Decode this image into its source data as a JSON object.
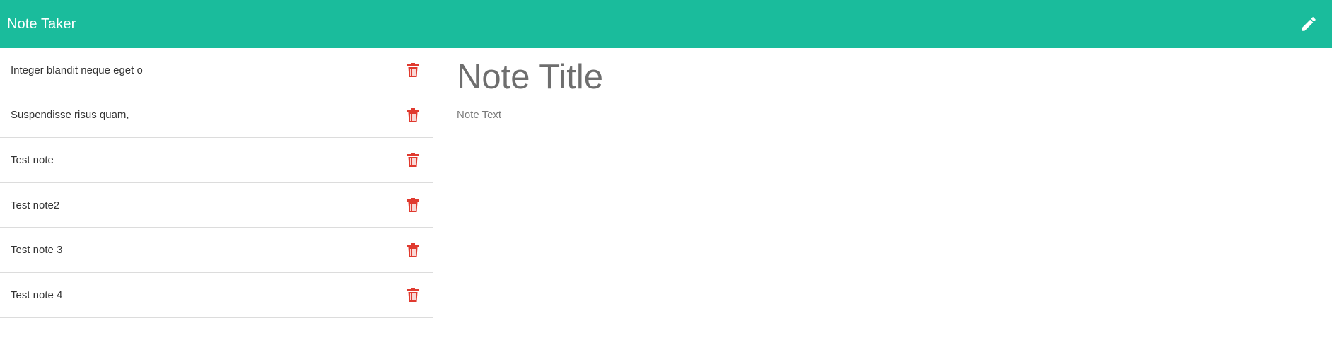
{
  "colors": {
    "navbar_bg": "#1abc9c",
    "delete_icon": "#e03a2f",
    "nav_text": "#ffffff"
  },
  "navbar": {
    "brand": "Note Taker",
    "new_note_icon": "pencil-icon"
  },
  "sidebar": {
    "notes": [
      {
        "title": "Integer blandit neque eget o",
        "delete_icon": "trash-icon"
      },
      {
        "title": "Suspendisse risus quam,",
        "delete_icon": "trash-icon"
      },
      {
        "title": "Test note",
        "delete_icon": "trash-icon"
      },
      {
        "title": "Test note2",
        "delete_icon": "trash-icon"
      },
      {
        "title": "Test note 3",
        "delete_icon": "trash-icon"
      },
      {
        "title": "Test note 4",
        "delete_icon": "trash-icon"
      }
    ]
  },
  "editor": {
    "title_placeholder": "Note Title",
    "title_value": "",
    "text_placeholder": "Note Text",
    "text_value": ""
  }
}
